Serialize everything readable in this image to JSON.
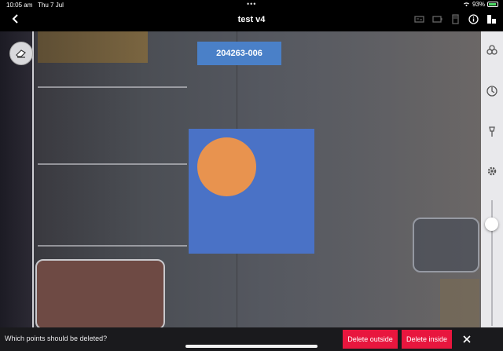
{
  "status": {
    "time": "10:05 am",
    "date": "Thu 7 Jul",
    "battery": "93%"
  },
  "header": {
    "title": "test v4"
  },
  "map": {
    "label": "204263-006"
  },
  "sidebar": {
    "slider_level": 0.15
  },
  "bottom": {
    "prompt": "Which points should be deleted?",
    "delete_outside": "Delete outside",
    "delete_inside": "Delete inside"
  },
  "colors": {
    "accent": "#e8163e",
    "selection": "#4a72c6",
    "marker": "#e8934f",
    "label_bg": "#4a80c8"
  }
}
